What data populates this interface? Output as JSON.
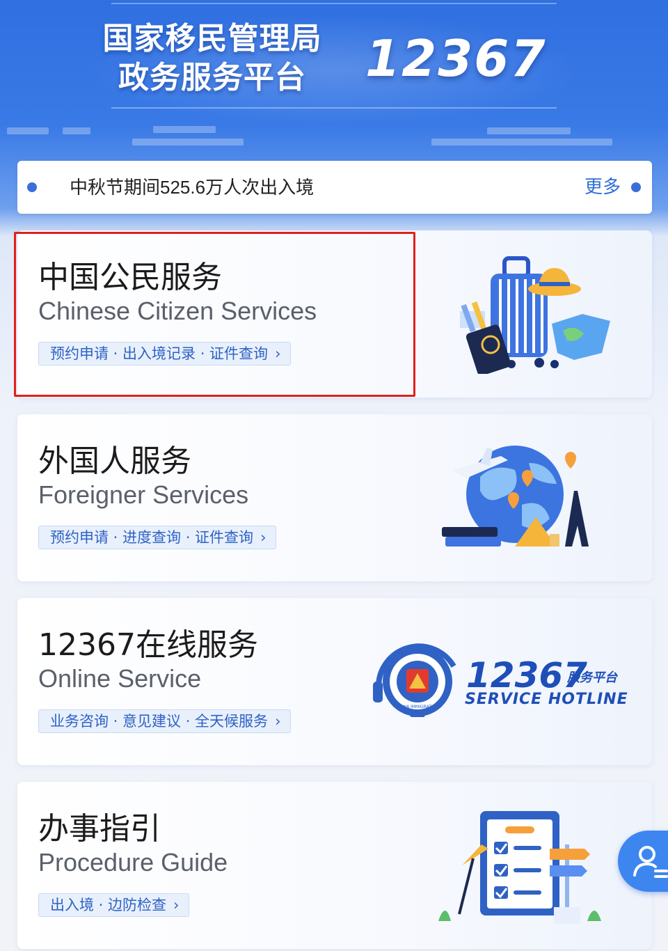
{
  "header": {
    "title_line1": "国家移民管理局",
    "title_line2": "政务服务平台",
    "hotline": "12367"
  },
  "notice": {
    "text": "中秋节期间525.6万人次出入境",
    "more_label": "更多"
  },
  "cards": [
    {
      "title_cn": "中国公民服务",
      "title_en": "Chinese Citizen Services",
      "links": "预约申请 · 出入境记录 · 证件查询",
      "icon": "luggage-passport-icon",
      "highlighted": true
    },
    {
      "title_cn": "外国人服务",
      "title_en": "Foreigner Services",
      "links": "预约申请 · 进度查询 · 证件查询",
      "icon": "globe-airplane-icon"
    },
    {
      "title_cn": "12367在线服务",
      "title_en": "Online Service",
      "links": "业务咨询 · 意见建议 · 全天候服务",
      "icon": "immigration-emblem-icon",
      "hotline_number": "12367",
      "hotline_cn": "服务平台",
      "hotline_en": "SERVICE HOTLINE",
      "emblem_text": "CHINA IMMIGRATION"
    },
    {
      "title_cn": "办事指引",
      "title_en": "Procedure Guide",
      "links": "出入境 · 边防检查",
      "icon": "checklist-signpost-icon"
    }
  ],
  "link_chevron": "›",
  "fab": {
    "icon": "user-service-icon"
  },
  "colors": {
    "primary_blue": "#2f6fd8",
    "highlight_red": "#e0201c",
    "pill_bg": "#e8f0fc"
  }
}
